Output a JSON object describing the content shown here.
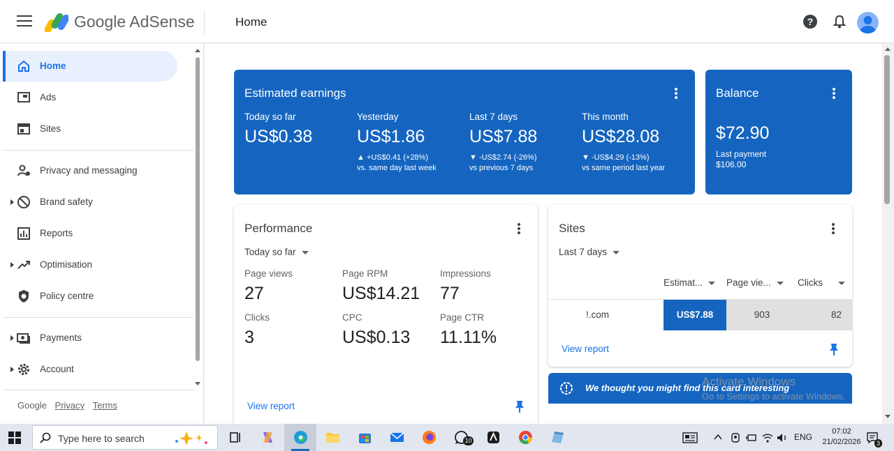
{
  "header": {
    "brand": "Google AdSense",
    "page_title": "Home"
  },
  "sidebar": {
    "items": [
      {
        "label": "Home",
        "icon": "home-icon"
      },
      {
        "label": "Ads",
        "icon": "ads-icon"
      },
      {
        "label": "Sites",
        "icon": "sites-icon"
      },
      {
        "label": "Privacy and messaging",
        "icon": "privacy-icon"
      },
      {
        "label": "Brand safety",
        "icon": "block-icon"
      },
      {
        "label": "Reports",
        "icon": "reports-icon"
      },
      {
        "label": "Optimisation",
        "icon": "trending-icon"
      },
      {
        "label": "Policy centre",
        "icon": "shield-icon"
      },
      {
        "label": "Payments",
        "icon": "payments-icon"
      },
      {
        "label": "Account",
        "icon": "gear-icon"
      }
    ],
    "footer": {
      "google": "Google",
      "privacy": "Privacy",
      "terms": "Terms"
    }
  },
  "earnings": {
    "title": "Estimated earnings",
    "today": {
      "label": "Today so far",
      "value": "US$0.38"
    },
    "yesterday": {
      "label": "Yesterday",
      "value": "US$1.86",
      "change": "▲ +US$0.41 (+28%)",
      "compare": "vs. same day last week"
    },
    "last7": {
      "label": "Last 7 days",
      "value": "US$7.88",
      "change": "▼ -US$2.74 (-26%)",
      "compare": "vs previous 7 days"
    },
    "month": {
      "label": "This month",
      "value": "US$28.08",
      "change": "▼ -US$4.29 (-13%)",
      "compare": "vs same period last year"
    }
  },
  "balance": {
    "title": "Balance",
    "value": "$72.90",
    "last_payment_label": "Last payment",
    "last_payment_value": "$106.00"
  },
  "performance": {
    "title": "Performance",
    "period": "Today so far",
    "metrics": [
      {
        "label": "Page views",
        "value": "27"
      },
      {
        "label": "Page RPM",
        "value": "US$14.21"
      },
      {
        "label": "Impressions",
        "value": "77"
      },
      {
        "label": "Clicks",
        "value": "3"
      },
      {
        "label": "CPC",
        "value": "US$0.13"
      },
      {
        "label": "Page CTR",
        "value": "11.11%"
      }
    ],
    "view_report": "View report"
  },
  "sites": {
    "title": "Sites",
    "period": "Last 7 days",
    "columns": [
      "Estimat...",
      "Page vie...",
      "Clicks"
    ],
    "row": {
      "site": "!.com",
      "estimated": "US$7.88",
      "page_views": "903",
      "clicks": "82"
    },
    "view_report": "View report"
  },
  "banner": {
    "text": "We thought you might find this card interesting"
  },
  "watermark": {
    "line1": "Activate Windows",
    "line2": "Go to Settings to activate Windows."
  },
  "taskbar": {
    "search_placeholder": "Type here to search",
    "whatsapp_badge": "10",
    "lang": "ENG",
    "time": "07:02",
    "date": "21/02/2026",
    "notifications": "3"
  },
  "colors": {
    "accent": "#1a73e8",
    "card_blue": "#1565c0",
    "active_bg": "#e8f0fe"
  }
}
